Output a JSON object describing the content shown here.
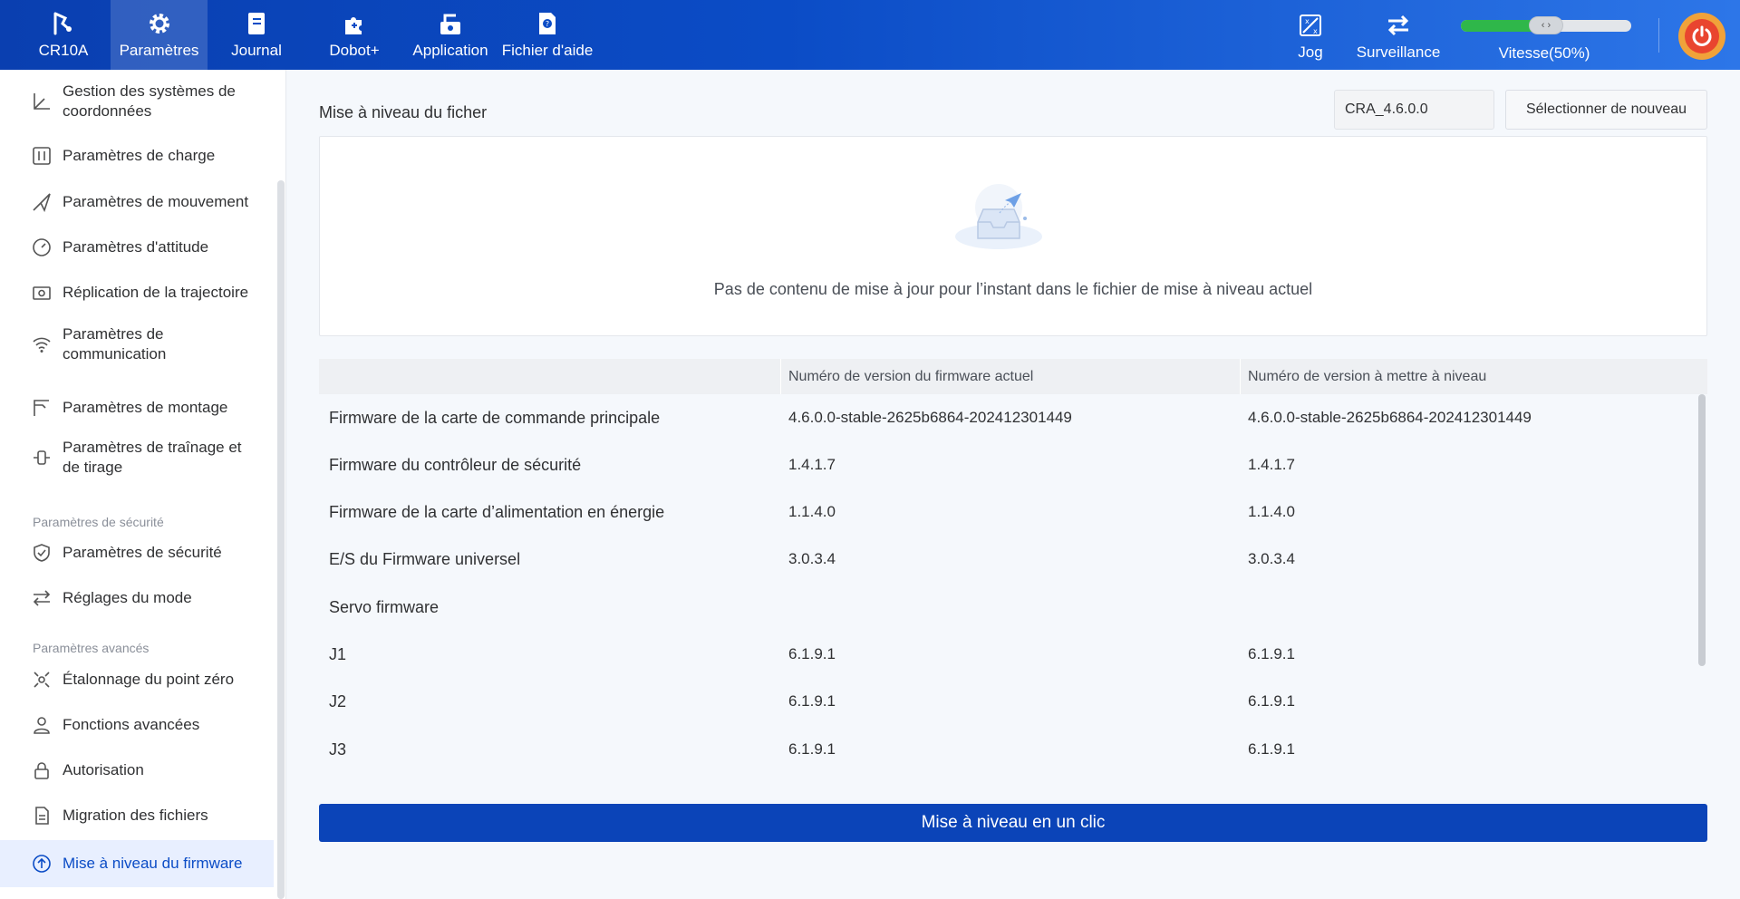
{
  "topbar": {
    "nav": [
      {
        "label": "CR10A",
        "icon": "robot-arm-icon"
      },
      {
        "label": "Paramètres",
        "icon": "gear-icon",
        "active": true
      },
      {
        "label": "Journal",
        "icon": "journal-icon"
      },
      {
        "label": "Dobot+",
        "icon": "puzzle-icon"
      },
      {
        "label": "Application",
        "icon": "application-icon"
      },
      {
        "label": "Fichier d'aide",
        "icon": "help-file-icon"
      }
    ],
    "jog_label": "Jog",
    "surveillance_label": "Surveillance",
    "speed_label": "Vitesse(50%)",
    "speed_percent": 50,
    "speed_knob_glyph": "‹ ›"
  },
  "sidebar": {
    "items": [
      {
        "label": "Gestion des systèmes de coordonnées",
        "icon": "coordinate-axes-icon"
      },
      {
        "label": "Paramètres de charge",
        "icon": "payload-icon"
      },
      {
        "label": "Paramètres de mouvement",
        "icon": "paper-plane-icon"
      },
      {
        "label": "Paramètres d'attitude",
        "icon": "gauge-icon"
      },
      {
        "label": "Réplication de la trajectoire",
        "icon": "camera-icon"
      },
      {
        "label": "Paramètres de communication",
        "icon": "wifi-icon"
      },
      {
        "label": "Paramètres de montage",
        "icon": "mount-icon"
      },
      {
        "label": "Paramètres de traînage et de tirage",
        "icon": "drag-icon"
      }
    ],
    "section_security": "Paramètres de sécurité",
    "security_items": [
      {
        "label": "Paramètres de sécurité",
        "icon": "shield-icon"
      },
      {
        "label": "Réglages du mode",
        "icon": "swap-arrows-icon"
      }
    ],
    "section_advanced": "Paramètres avancés",
    "advanced_items": [
      {
        "label": "Étalonnage du point zéro",
        "icon": "calibration-icon"
      },
      {
        "label": "Fonctions avancées",
        "icon": "user-icon"
      },
      {
        "label": "Autorisation",
        "icon": "lock-icon"
      },
      {
        "label": "Migration des fichiers",
        "icon": "file-migration-icon"
      },
      {
        "label": "Mise à niveau du firmware",
        "icon": "upgrade-icon",
        "active": true
      }
    ]
  },
  "main": {
    "title": "Mise à niveau du ficher",
    "version_value": "CRA_4.6.0.0",
    "reselect_label": "Sélectionner de nouveau",
    "empty_message": "Pas de contenu de mise à jour pour l’instant dans le fichier de mise à niveau actuel",
    "table": {
      "headers": [
        "",
        "Numéro de version du firmware actuel",
        "Numéro de version à mettre à niveau"
      ],
      "rows": [
        [
          "Firmware de la carte de commande principale",
          "4.6.0.0-stable-2625b6864-202412301449",
          "4.6.0.0-stable-2625b6864-202412301449"
        ],
        [
          "Firmware du contrôleur de sécurité",
          "1.4.1.7",
          "1.4.1.7"
        ],
        [
          "Firmware de la carte d’alimentation en énergie",
          "1.1.4.0",
          "1.1.4.0"
        ],
        [
          "E/S du Firmware universel",
          "3.0.3.4",
          "3.0.3.4"
        ],
        [
          "Servo firmware",
          "",
          ""
        ],
        [
          "J1",
          "6.1.9.1",
          "6.1.9.1"
        ],
        [
          "J2",
          "6.1.9.1",
          "6.1.9.1"
        ],
        [
          "J3",
          "6.1.9.1",
          "6.1.9.1"
        ]
      ]
    },
    "upgrade_label": "Mise à niveau en un clic"
  },
  "colors": {
    "brand_blue": "#0b44b8",
    "speed_green": "#2fb74a",
    "power_red": "#e9452f"
  }
}
